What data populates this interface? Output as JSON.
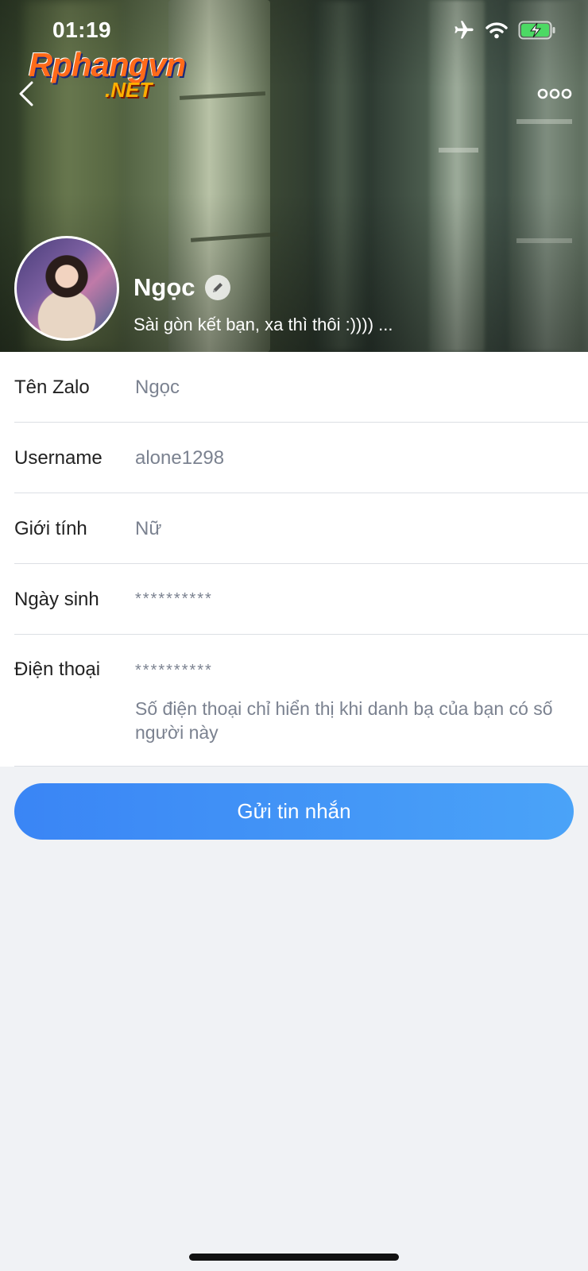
{
  "status_bar": {
    "time": "01:19",
    "icons": [
      "airplane-icon",
      "wifi-icon",
      "battery-charging-icon"
    ]
  },
  "watermark": {
    "main": "Rphangvn",
    "sub": ".NET"
  },
  "nav": {
    "back_icon": "chevron-left-icon",
    "more_icon": "more-dots-icon"
  },
  "profile": {
    "name": "Ngọc",
    "status": "Sài gòn kết bạn, xa thì thôi :)))) ...",
    "edit_icon": "pencil-icon"
  },
  "info": {
    "rows": [
      {
        "label": "Tên Zalo",
        "value": "Ngọc"
      },
      {
        "label": "Username",
        "value": "alone1298"
      },
      {
        "label": "Giới tính",
        "value": "Nữ"
      },
      {
        "label": "Ngày sinh",
        "value": "**********"
      },
      {
        "label": "Điện thoại",
        "value": "**********"
      }
    ],
    "phone_note": "Số điện thoại chỉ hiển thị khi danh bạ của bạn có số người này"
  },
  "actions": {
    "send_message": "Gửi tin nhắn"
  },
  "colors": {
    "accent": "#3a85f5",
    "background": "#f0f2f5",
    "value_text": "#7b8290"
  }
}
